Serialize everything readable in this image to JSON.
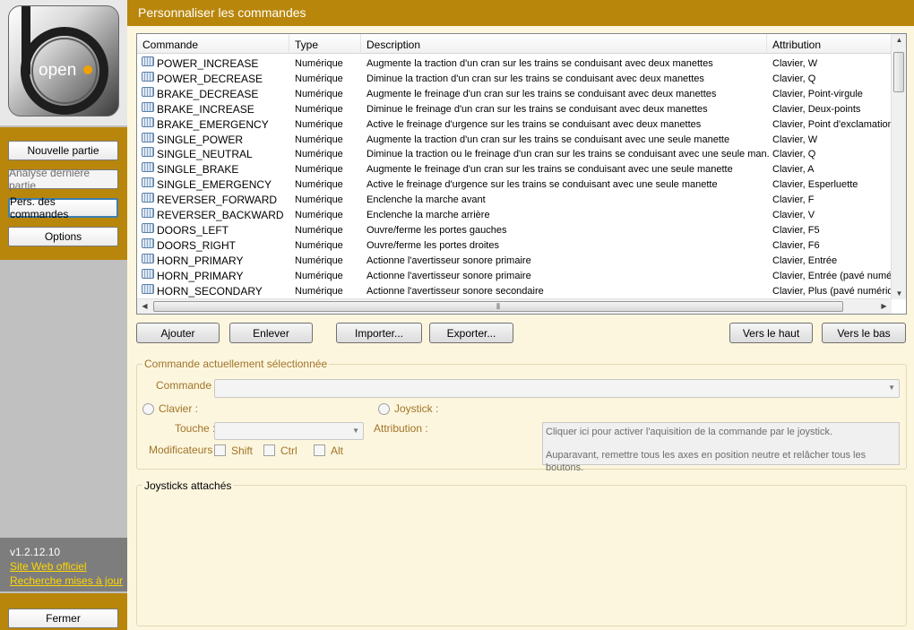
{
  "sidebar": {
    "logo_text": "open",
    "buttons": {
      "new_game": "Nouvelle partie",
      "last_game_analysis": "Analyse dernière partie",
      "customize_controls": "Pers. des commandes",
      "options": "Options"
    },
    "version": "v1.2.12.10",
    "link_website": "Site Web officiel",
    "link_updates": "Recherche mises à jour",
    "close_button": "Fermer"
  },
  "main": {
    "title": "Personnaliser les commandes",
    "table": {
      "columns": [
        "Commande",
        "Type",
        "Description",
        "Attribution"
      ],
      "rows": [
        {
          "command": "POWER_INCREASE",
          "type": "Numérique",
          "description": "Augmente la traction d'un cran sur les trains se conduisant avec deux manettes",
          "attribution": "Clavier, W"
        },
        {
          "command": "POWER_DECREASE",
          "type": "Numérique",
          "description": "Diminue la traction d'un cran sur les trains se conduisant avec deux manettes",
          "attribution": "Clavier, Q"
        },
        {
          "command": "BRAKE_DECREASE",
          "type": "Numérique",
          "description": "Augmente le freinage d'un cran sur les trains se conduisant avec deux manettes",
          "attribution": "Clavier, Point-virgule"
        },
        {
          "command": "BRAKE_INCREASE",
          "type": "Numérique",
          "description": "Diminue le freinage d'un cran sur les trains se conduisant avec deux manettes",
          "attribution": "Clavier, Deux-points"
        },
        {
          "command": "BRAKE_EMERGENCY",
          "type": "Numérique",
          "description": "Active le freinage d'urgence sur les trains se conduisant avec deux manettes",
          "attribution": "Clavier, Point d'exclamation"
        },
        {
          "command": "SINGLE_POWER",
          "type": "Numérique",
          "description": "Augmente la traction d'un cran sur les trains se conduisant avec une seule manette",
          "attribution": "Clavier, W"
        },
        {
          "command": "SINGLE_NEUTRAL",
          "type": "Numérique",
          "description": "Diminue la traction ou le freinage d'un cran sur les trains se conduisant avec une seule man...",
          "attribution": "Clavier, Q"
        },
        {
          "command": "SINGLE_BRAKE",
          "type": "Numérique",
          "description": "Augmente le freinage d'un cran sur les trains se conduisant avec une seule manette",
          "attribution": "Clavier, A"
        },
        {
          "command": "SINGLE_EMERGENCY",
          "type": "Numérique",
          "description": "Active le freinage d'urgence sur les trains se conduisant avec une seule manette",
          "attribution": "Clavier, Esperluette"
        },
        {
          "command": "REVERSER_FORWARD",
          "type": "Numérique",
          "description": "Enclenche la marche avant",
          "attribution": "Clavier, F"
        },
        {
          "command": "REVERSER_BACKWARD",
          "type": "Numérique",
          "description": "Enclenche la marche arrière",
          "attribution": "Clavier, V"
        },
        {
          "command": "DOORS_LEFT",
          "type": "Numérique",
          "description": "Ouvre/ferme les portes gauches",
          "attribution": "Clavier, F5"
        },
        {
          "command": "DOORS_RIGHT",
          "type": "Numérique",
          "description": "Ouvre/ferme les portes droites",
          "attribution": "Clavier, F6"
        },
        {
          "command": "HORN_PRIMARY",
          "type": "Numérique",
          "description": "Actionne l'avertisseur sonore primaire",
          "attribution": "Clavier, Entrée"
        },
        {
          "command": "HORN_PRIMARY",
          "type": "Numérique",
          "description": "Actionne l'avertisseur sonore primaire",
          "attribution": "Clavier, Entrée (pavé numérique)"
        },
        {
          "command": "HORN_SECONDARY",
          "type": "Numérique",
          "description": "Actionne l'avertisseur sonore secondaire",
          "attribution": "Clavier, Plus (pavé numérique)"
        }
      ]
    },
    "actions": {
      "add": "Ajouter",
      "remove": "Enlever",
      "import": "Importer...",
      "export": "Exporter...",
      "move_up": "Vers le haut",
      "move_down": "Vers le bas"
    },
    "selected_command": {
      "group_title": "Commande actuellement sélectionnée",
      "command_label": "Commande :",
      "command_value": "",
      "keyboard_label": "Clavier :",
      "joystick_label": "Joystick :",
      "key_label": "Touche :",
      "key_value": "",
      "attribution_label": "Attribution :",
      "modifiers_label": "Modificateurs :",
      "modifiers": [
        "Shift",
        "Ctrl",
        "Alt"
      ],
      "joystick_hint_1": "Cliquer ici pour activer l'aquisition de la commande par le joystick.",
      "joystick_hint_2": "Auparavant, remettre tous les axes en position neutre et relâcher tous les boutons."
    },
    "joysticks": {
      "group_title": "Joysticks attachés"
    }
  },
  "colors": {
    "accent": "#b8860b",
    "panel": "#fdf6de",
    "label": "#a0742a"
  }
}
